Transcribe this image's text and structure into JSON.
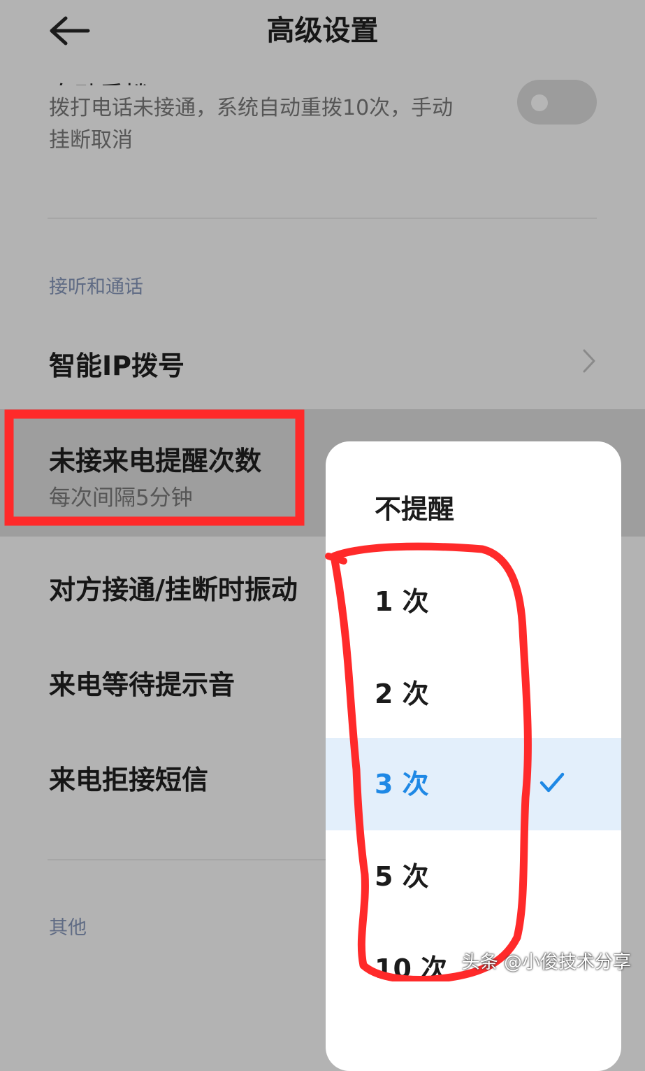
{
  "header": {
    "title": "高级设置",
    "back_icon": "arrow-left-icon"
  },
  "auto_redial": {
    "title": "自动重拨",
    "description_line1": "拨打电话未接通，系统自动重拨10次，手动",
    "description_line2": "挂断取消",
    "toggle_on": false
  },
  "sections": {
    "answer_and_call": "接听和通话",
    "other": "其他"
  },
  "items": {
    "smart_ip": "智能IP拨号",
    "missed_call_reminder": "未接来电提醒次数",
    "missed_call_reminder_sub": "每次间隔5分钟",
    "vibrate_on_connect": "对方接通/挂断时振动",
    "call_waiting_tone": "来电等待提示音",
    "reject_sms": "来电拒接短信"
  },
  "popup": {
    "options": [
      "不提醒",
      "1 次",
      "2 次",
      "3 次",
      "5 次",
      "10 次"
    ],
    "selected": "3 次",
    "check_icon": "checkmark-icon"
  },
  "watermark": "头条 @小俊技术分享",
  "colors": {
    "annotation_red": "#ff2a2a",
    "accent_blue": "#1e88e5"
  }
}
